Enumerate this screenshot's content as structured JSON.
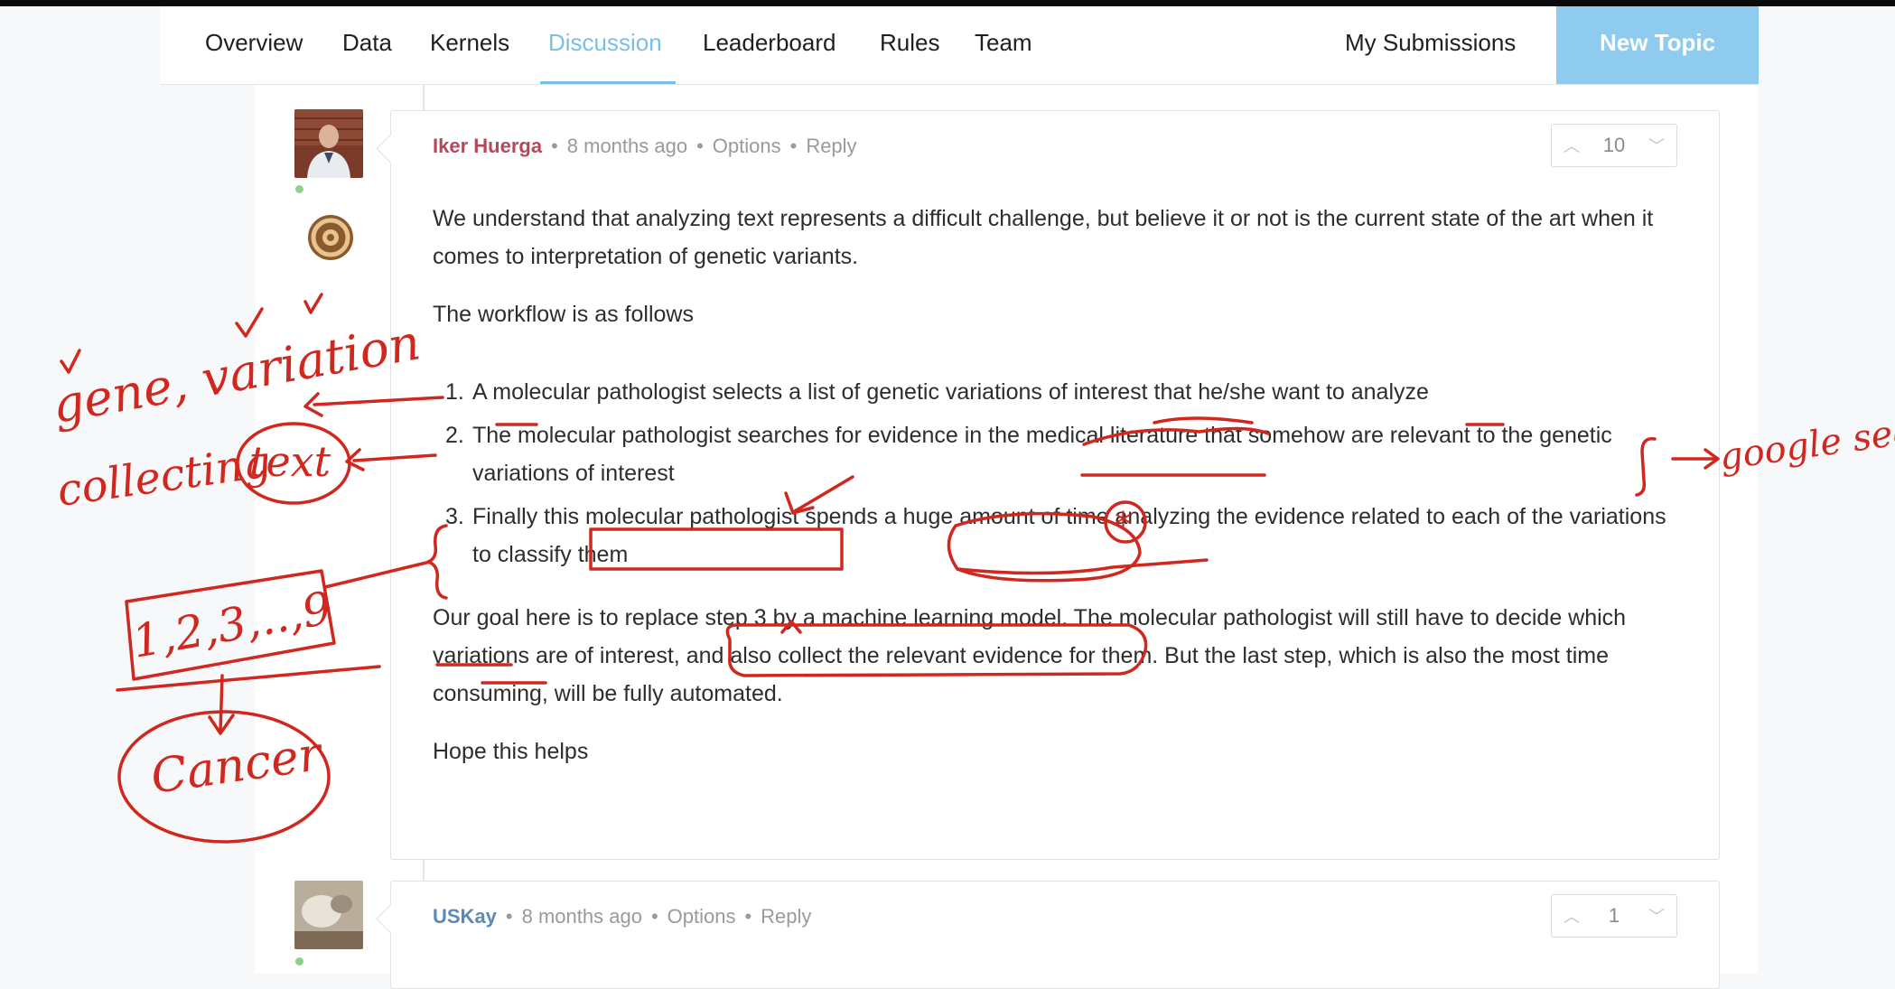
{
  "nav": {
    "tabs": [
      {
        "label": "Overview"
      },
      {
        "label": "Data"
      },
      {
        "label": "Kernels"
      },
      {
        "label": "Discussion"
      },
      {
        "label": "Leaderboard"
      },
      {
        "label": "Rules"
      },
      {
        "label": "Team"
      }
    ],
    "active_tab": "Discussion",
    "my_submissions": "My Submissions",
    "new_topic": "New Topic"
  },
  "comments": [
    {
      "author": "Iker Huerga",
      "time": "8 months ago",
      "options": "Options",
      "reply": "Reply",
      "votes": "10",
      "body": {
        "p1": "We understand that analyzing text represents a difficult challenge, but believe it or not is the current state of the art when it comes to interpretation of genetic variants.",
        "p2": "The workflow is as follows",
        "steps": [
          {
            "num": "1.",
            "text": "A molecular pathologist selects a list of genetic variations of interest that he/she want to analyze"
          },
          {
            "num": "2.",
            "text": "The molecular pathologist searches for evidence in the medical literature that somehow are relevant to the genetic variations of interest"
          },
          {
            "num": "3.",
            "text": "Finally this molecular pathologist spends a huge amount of time analyzing the evidence related to each of the variations to classify them"
          }
        ],
        "p3": "Our goal here is to replace step 3 by a machine learning model. The molecular pathologist will still have to decide which variations are of interest, and also collect the relevant evidence for them. But the last step, which is also the most time consuming, will be fully automated.",
        "p4": "Hope this helps"
      }
    },
    {
      "author": "USKay",
      "time": "8 months ago",
      "options": "Options",
      "reply": "Reply",
      "votes": "1"
    }
  ],
  "handwriting": {
    "note_gene": "gene, variation",
    "note_collecting": "collecting",
    "note_text": "text",
    "note_classes": "1,2,3,..,9",
    "note_cancer": "Cancer",
    "note_google": "google search",
    "star": "*",
    "ink_color": "#d0271f"
  },
  "colors": {
    "accent": "#79bfe7",
    "new_topic_bg": "#8ecbee",
    "author_red": "#b5485a",
    "author_blue": "#5b89b8"
  }
}
